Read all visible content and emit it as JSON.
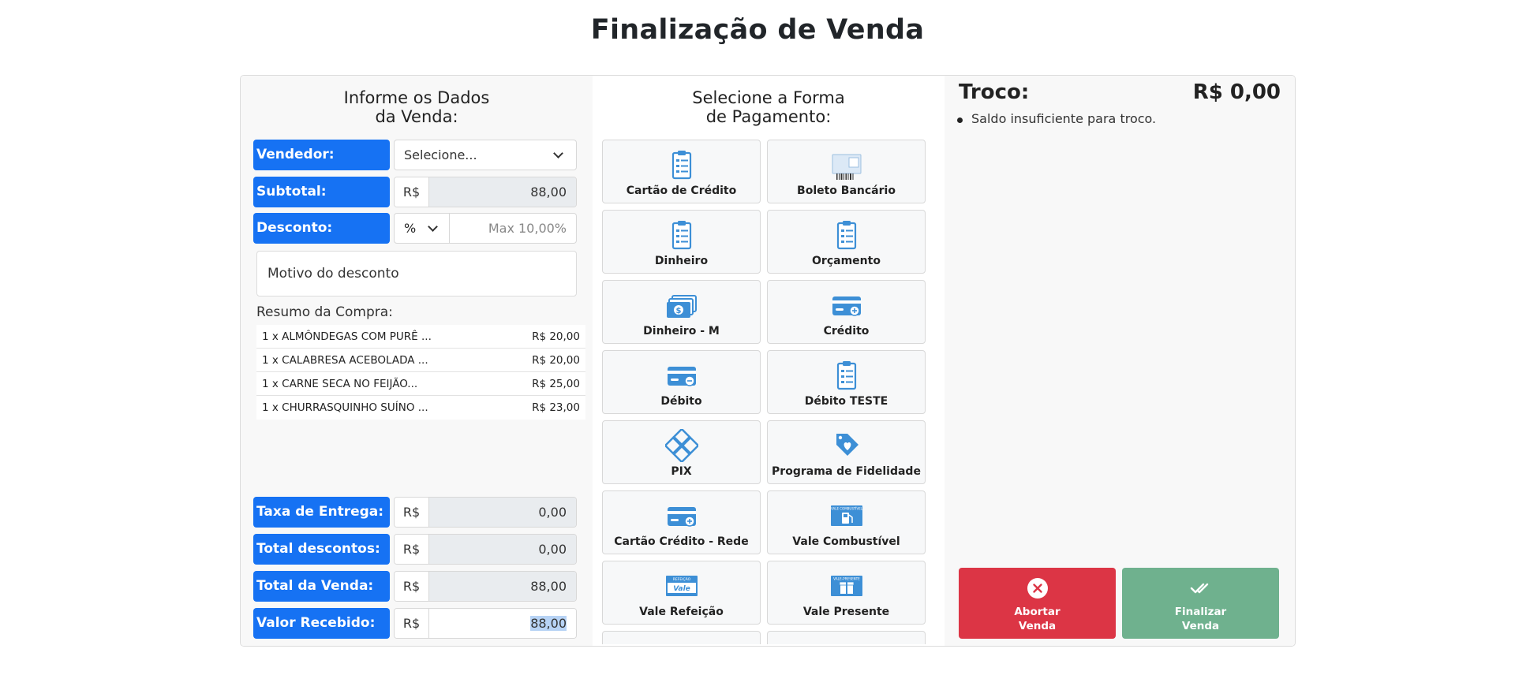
{
  "page": {
    "title": "Finalização de Venda"
  },
  "left": {
    "heading_line1": "Informe os Dados",
    "heading_line2": "da Venda:",
    "vendedor": {
      "label": "Vendedor:",
      "value": "Selecione..."
    },
    "subtotal": {
      "label": "Subtotal:",
      "currency": "R$",
      "value": "88,00"
    },
    "desconto": {
      "label": "Desconto:",
      "type": "%",
      "placeholder": "Max 10,00%"
    },
    "motivo_placeholder": "Motivo do desconto",
    "resumo_title": "Resumo da Compra:",
    "resumo_items": [
      {
        "name": "1 x ALMÔNDEGAS COM PURÊ ...",
        "price": "R$ 20,00"
      },
      {
        "name": "1 x CALABRESA ACEBOLADA ...",
        "price": "R$ 20,00"
      },
      {
        "name": "1 x CARNE SECA NO FEIJÃO...",
        "price": "R$ 25,00"
      },
      {
        "name": "1 x CHURRASQUINHO SUÍNO ...",
        "price": "R$ 23,00"
      }
    ],
    "taxa_entrega": {
      "label": "Taxa de Entrega:",
      "currency": "R$",
      "value": "0,00"
    },
    "total_descontos": {
      "label": "Total descontos:",
      "currency": "R$",
      "value": "0,00"
    },
    "total_venda": {
      "label": "Total da Venda:",
      "currency": "R$",
      "value": "88,00"
    },
    "valor_recebido": {
      "label": "Valor Recebido:",
      "currency": "R$",
      "value": "88,00"
    }
  },
  "middle": {
    "heading_line1": "Selecione a Forma",
    "heading_line2": "de Pagamento:",
    "payment_methods": [
      {
        "label": "Cartão de Crédito",
        "icon": "clipboard-icon"
      },
      {
        "label": "Boleto Bancário",
        "icon": "barcode-icon"
      },
      {
        "label": "Dinheiro",
        "icon": "clipboard-icon"
      },
      {
        "label": "Orçamento",
        "icon": "clipboard-icon"
      },
      {
        "label": "Dinheiro - M",
        "icon": "banknotes-icon"
      },
      {
        "label": "Crédito",
        "icon": "card-plus-icon"
      },
      {
        "label": "Débito",
        "icon": "card-minus-icon"
      },
      {
        "label": "Débito TESTE",
        "icon": "clipboard-icon"
      },
      {
        "label": "PIX",
        "icon": "pix-icon"
      },
      {
        "label": "Programa de Fidelidade",
        "icon": "loyalty-tag-icon"
      },
      {
        "label": "Cartão Crédito - Rede",
        "icon": "card-plus-icon"
      },
      {
        "label": "Vale Combustível",
        "icon": "fuel-voucher-icon"
      },
      {
        "label": "Vale Refeição",
        "icon": "meal-voucher-icon"
      },
      {
        "label": "Vale Presente",
        "icon": "gift-voucher-icon"
      }
    ],
    "meal_voucher_text_top": "REFEIÇÃO",
    "meal_voucher_text": "Vale",
    "fuel_voucher_text": "VALE COMBUSTÍVEL",
    "gift_voucher_text": "VALE-PRESENTE"
  },
  "right": {
    "troco_label": "Troco:",
    "troco_value": "R$ 0,00",
    "troco_message": "Saldo insuficiente para troco.",
    "abort_line1": "Abortar",
    "abort_line2": "Venda",
    "finish_line1": "Finalizar",
    "finish_line2": "Venda"
  },
  "colors": {
    "primary": "#1672f3",
    "danger": "#dc3545",
    "success": "#6fb18e",
    "icon": "#3d8fd6"
  }
}
